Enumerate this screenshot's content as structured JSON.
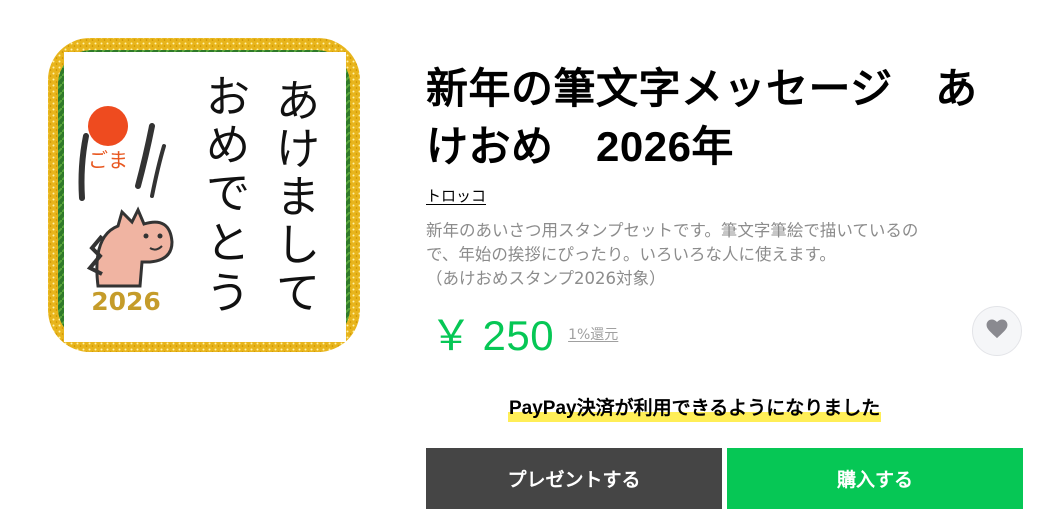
{
  "product": {
    "title_line1": "新年の筆文字メッセージ　あ",
    "title_line2": "けおめ　2026年",
    "author": "トロッコ",
    "description_lines": [
      "新年のあいさつ用スタンプセットです。筆文字筆絵で描いているの",
      "で、年始の挨拶にぴったり。いろいろな人に使えます。",
      "（あけおめスタンプ2026対象）"
    ],
    "price_currency": "￥",
    "price_value": "250",
    "reward_text": "1%還元",
    "thumbnail": {
      "year_text": "2026",
      "calligraphy_chars": [
        "あ",
        "け",
        "ま",
        "し",
        "て",
        "お",
        "め",
        "で",
        "と",
        "う"
      ]
    }
  },
  "notice": {
    "paypay": "PayPay決済が利用できるようになりました"
  },
  "actions": {
    "gift_label": "プレゼントする",
    "buy_label": "購入する"
  },
  "icons": {
    "favorite": "heart-icon"
  },
  "colors": {
    "accent": "#06c755",
    "gift_button": "#454545",
    "highlight": "#ffee57"
  }
}
